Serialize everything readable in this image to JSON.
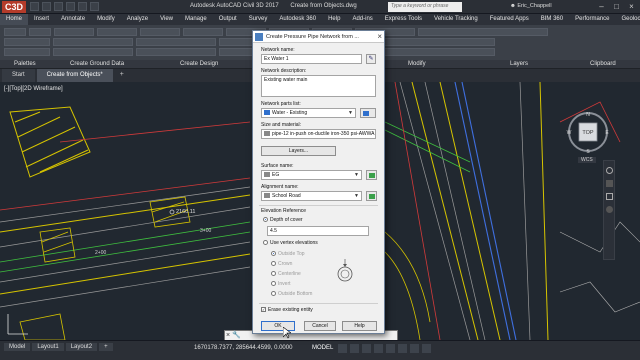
{
  "window": {
    "app_logo": "C3D",
    "title": "Autodesk AutoCAD Civil 3D 2017",
    "file_title": "Create from Objects.dwg",
    "search_placeholder": "Type a keyword or phrase",
    "user": "Eric_Chappell"
  },
  "ribbon_tabs": [
    "Home",
    "Insert",
    "Annotate",
    "Modify",
    "Analyze",
    "View",
    "Manage",
    "Output",
    "Survey",
    "Autodesk 360",
    "Help",
    "Add-ins",
    "Express Tools",
    "Vehicle Tracking",
    "Featured Apps",
    "BIM 360",
    "Performance",
    "Geolocation"
  ],
  "ribbon_active_tab": "Home",
  "panel_labels": [
    "Palettes",
    "Create Ground Data",
    "Create Design",
    "Modify",
    "Layers",
    "Clipboard"
  ],
  "doc_tabs": [
    "Start",
    "Create from Objects*"
  ],
  "viewport_label": "[-][Top][2D Wireframe]",
  "drawing_labels": {
    "station": "2160.11",
    "station2": "2+00",
    "station3": "3+00"
  },
  "viewcube": {
    "top": "TOP",
    "n": "N",
    "s": "S",
    "e": "E",
    "w": "W",
    "wcs": "WCS"
  },
  "status": {
    "layouts": [
      "Model",
      "Layout1",
      "Layout2"
    ],
    "coords": "1670178.7377, 285644.4599, 0.0000",
    "model": "MODEL"
  },
  "dialog": {
    "title": "Create Pressure Pipe Network from ...",
    "network_name_label": "Network name:",
    "network_name_value": "Ex Water 1",
    "network_desc_label": "Network description:",
    "network_desc_value": "Existing water main",
    "parts_list_label": "Network parts list:",
    "parts_list_value": "Water - Existing",
    "size_material_label": "Size and material:",
    "size_material_value": "pipe-12 in-push on-ductile iron-350 psi-AWWA",
    "layers_button": "Layers...",
    "surface_label": "Surface name:",
    "surface_value": "EG",
    "alignment_label": "Alignment name:",
    "alignment_value": "School Road",
    "elevation_ref_label": "Elevation Reference",
    "depth_cover_label": "Depth of cover",
    "depth_cover_value": "4.5",
    "use_vertex_label": "Use vertex elevations",
    "vertex_options": [
      "Outside Top",
      "Crown",
      "Centerline",
      "Invert",
      "Outside Bottom"
    ],
    "erase_label": "Erase existing entity",
    "erase_checked": true,
    "ok_label": "OK",
    "cancel_label": "Cancel",
    "help_label": "Help"
  },
  "colors": {
    "accent": "#4a7fc0",
    "drawing_bg": "#212830",
    "surface_icon": "#3aa04a",
    "parts_icon": "#2f6fcc"
  }
}
